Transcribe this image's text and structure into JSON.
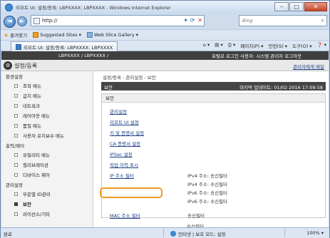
{
  "window": {
    "title": "리모트 UI: 설정/등록: LBPXXXX: LBPXXXX - Windows Internet Explorer",
    "minimize": "–",
    "maximize": "□",
    "close": "✕"
  },
  "nav": {
    "back": "◄",
    "forward": "►",
    "address": "http://",
    "search_placeholder": "Bing"
  },
  "favorites": {
    "label": "즐겨찾기",
    "items": [
      "Suggested Sites ▾",
      "Web Slice Gallery ▾"
    ]
  },
  "tab": {
    "label": "리모트 UI: 설정/등록: LBPXXXX: LBPXXXX"
  },
  "commands": {
    "page": "페이지(P) ▾",
    "safety": "안전(S) ▾",
    "tools": "도구(O) ▾",
    "help": "❓ ▾"
  },
  "app_header": {
    "device": "LBPXXXX / LBPXXXX /",
    "right": "포털로   로그인 사용자: 시스템 관리자 로그아웃"
  },
  "page": {
    "title": "설정/등록",
    "admin_link": "관리자에게 메일"
  },
  "sidebar": {
    "categories": [
      "환경설정",
      "출력/제어",
      "관리설정"
    ],
    "env_items": [
      "조작 메뉴",
      "급지 메뉴",
      "네트워크",
      "레이아웃 메뉴",
      "품질 메뉴",
      "사용자 유지보수 메뉴"
    ],
    "output_items": [
      "유틸리티 메뉴",
      "캘리브레이션",
      "디바이스 제어"
    ],
    "admin_items": [
      "부문별 ID관리",
      "보안",
      "라이선스/기타"
    ]
  },
  "main": {
    "breadcrumb": "설정/등록 : 관리설정 : 보안",
    "section_title": "보안",
    "last_update": "마지막 업데이트: 01/02 2016 17:09:58",
    "panel_title": "보안",
    "links": [
      "관리설정",
      "리모트 UI 설정",
      "키 및 증명서 설정",
      "CA 증명서 설정",
      "IPSec 설정",
      "작업 이력 표시",
      "IP 주소 필터",
      "MAC 주소 필터"
    ],
    "ip_filter_status": [
      "IPv4 주소: 송신필터",
      "IPv4 주소: 수신필터",
      "IPv6 주소: 송신필터",
      "IPv6 주소: 수신필터"
    ],
    "mac_filter_status": [
      "송신필터",
      "수신필터"
    ]
  },
  "statusbar": {
    "left": "완료",
    "zone": "인터넷 | 보호 모드: 설정",
    "zoom": "100% ▾"
  },
  "colors": {
    "highlight": "#f39a1e",
    "header_dark": "#3f3f3f",
    "link": "#1a3f86"
  }
}
